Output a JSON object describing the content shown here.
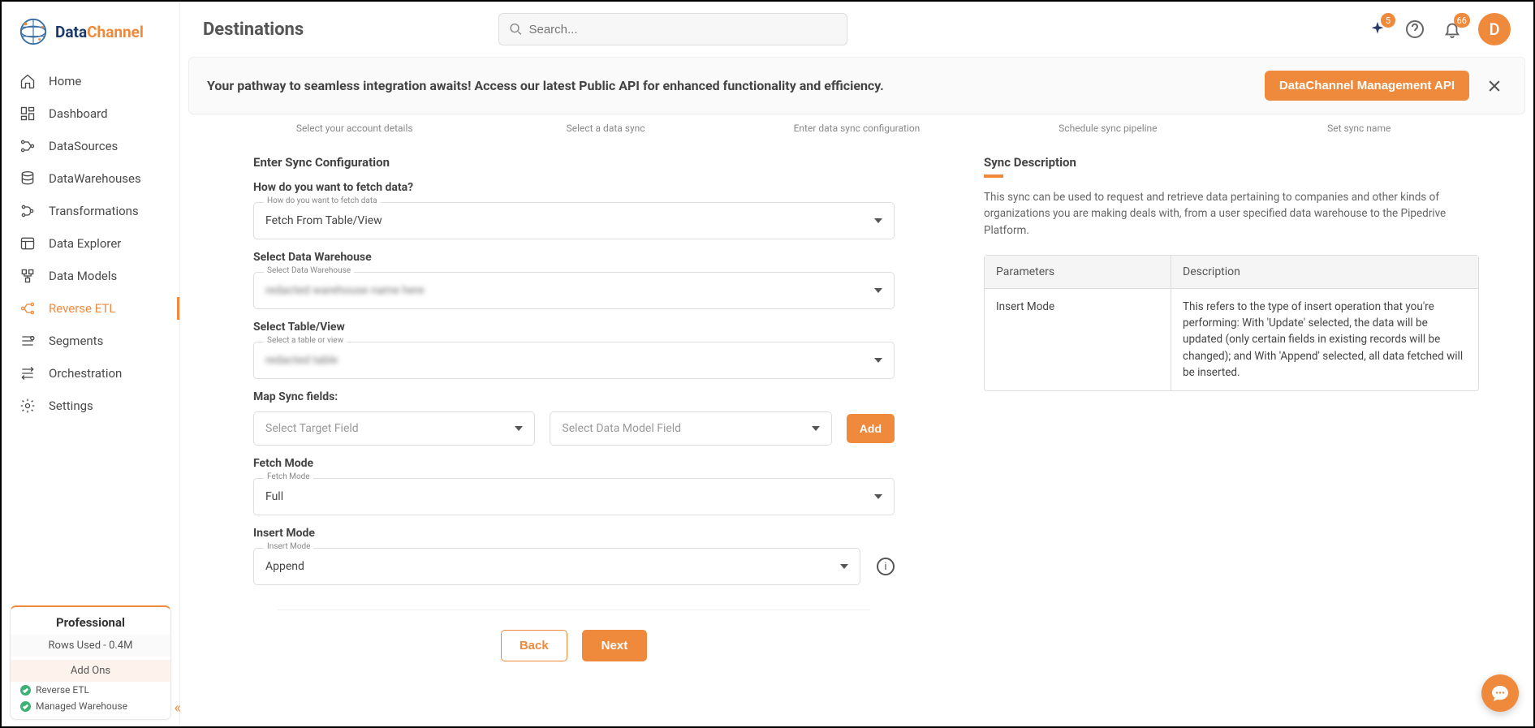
{
  "brand": {
    "data": "Data",
    "channel": "Channel"
  },
  "nav": {
    "items": [
      {
        "label": "Home"
      },
      {
        "label": "Dashboard"
      },
      {
        "label": "DataSources"
      },
      {
        "label": "DataWarehouses"
      },
      {
        "label": "Transformations"
      },
      {
        "label": "Data Explorer"
      },
      {
        "label": "Data Models"
      },
      {
        "label": "Reverse ETL"
      },
      {
        "label": "Segments"
      },
      {
        "label": "Orchestration"
      },
      {
        "label": "Settings"
      }
    ]
  },
  "plan": {
    "name": "Professional",
    "rows": "Rows Used - 0.4M",
    "addons_header": "Add Ons",
    "addons": [
      "Reverse ETL",
      "Managed Warehouse"
    ]
  },
  "header": {
    "title": "Destinations",
    "search_placeholder": "Search...",
    "badge_sparkle": "5",
    "badge_bell": "66",
    "avatar_initial": "D"
  },
  "banner": {
    "text": "Your pathway to seamless integration awaits! Access our latest Public API for enhanced functionality and efficiency.",
    "button": "DataChannel Management API"
  },
  "stepper": [
    "Select your account details",
    "Select a data sync",
    "Enter data sync configuration",
    "Schedule sync pipeline",
    "Set sync name"
  ],
  "form": {
    "section_title": "Enter Sync Configuration",
    "fetch_question": "How do you want to fetch data?",
    "fetch_float": "How do you want to fetch data",
    "fetch_value": "Fetch From Table/View",
    "dw_label": "Select Data Warehouse",
    "dw_float": "Select Data Warehouse",
    "table_label": "Select Table/View",
    "table_float": "Select a table or view",
    "map_label": "Map Sync fields:",
    "target_placeholder": "Select Target Field",
    "model_placeholder": "Select Data Model Field",
    "add_btn": "Add",
    "fetchmode_label": "Fetch Mode",
    "fetchmode_float": "Fetch Mode",
    "fetchmode_value": "Full",
    "insertmode_label": "Insert Mode",
    "insertmode_float": "Insert Mode",
    "insertmode_value": "Append",
    "back_btn": "Back",
    "next_btn": "Next"
  },
  "desc": {
    "title": "Sync Description",
    "text": "This sync can be used to request and retrieve data pertaining to companies and other kinds of organizations you are making deals with, from a user specified data warehouse to the Pipedrive Platform.",
    "th1": "Parameters",
    "th2": "Description",
    "row_param": "Insert Mode",
    "row_desc": "This refers to the type of insert operation that you're performing: With 'Update' selected, the data will be updated (only certain fields in existing records will be changed); and With 'Append' selected, all data fetched will be inserted."
  }
}
